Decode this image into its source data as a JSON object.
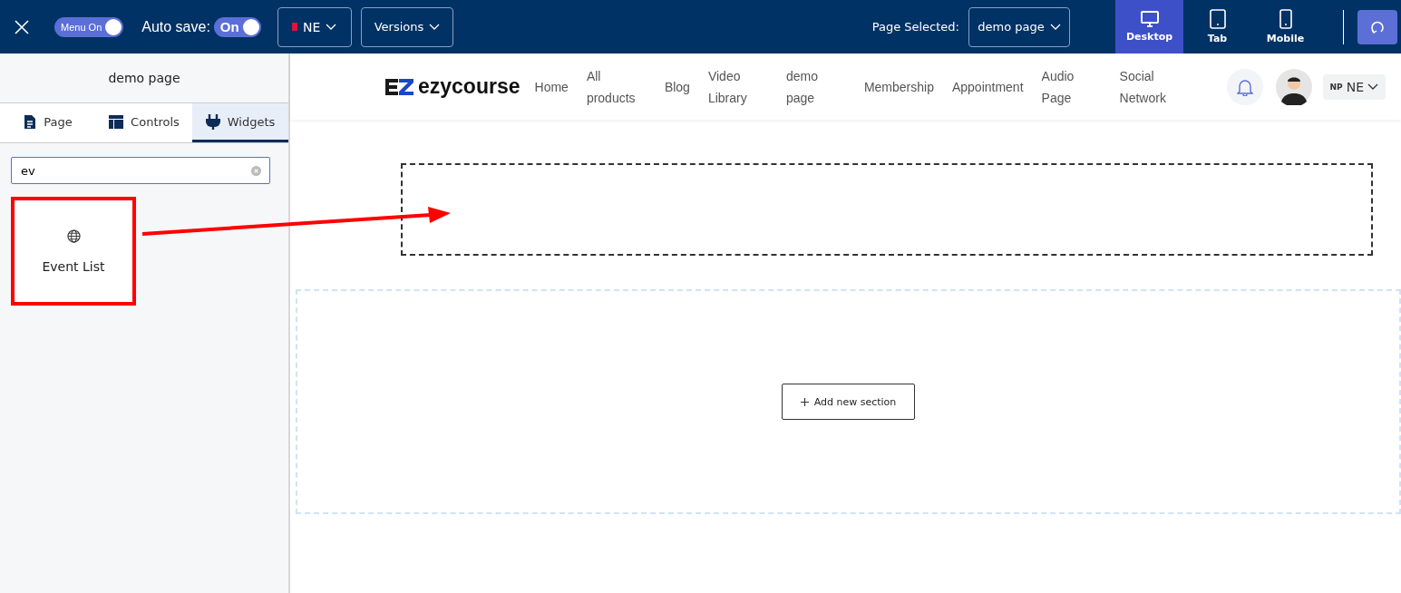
{
  "toolbar": {
    "menu_toggle": {
      "label": "Menu On",
      "on": true
    },
    "auto_save": {
      "label": "Auto save:",
      "toggle_label": "On",
      "on": true
    },
    "language": {
      "label": "NE"
    },
    "versions": {
      "label": "Versions"
    },
    "page_selected": {
      "label": "Page Selected:",
      "value": "demo page"
    },
    "devices": [
      {
        "label": "Desktop",
        "kind": "desktop",
        "selected": true
      },
      {
        "label": "Tab",
        "kind": "tablet",
        "selected": false
      },
      {
        "label": "Mobile",
        "kind": "mobile",
        "selected": false
      }
    ]
  },
  "sidebar": {
    "title": "demo page",
    "tabs": [
      {
        "label": "Page",
        "kind": "page",
        "selected": false
      },
      {
        "label": "Controls",
        "kind": "controls",
        "selected": false
      },
      {
        "label": "Widgets",
        "kind": "widgets",
        "selected": true
      }
    ],
    "search": {
      "value": "ev"
    },
    "widgets": [
      {
        "label": "Event List",
        "highlighted": true
      }
    ]
  },
  "preview": {
    "logo": "ezycourse",
    "nav": [
      "Home",
      "All products",
      "Blog",
      "Video Library",
      "demo page",
      "Membership",
      "Appointment",
      "Audio Page",
      "Social Network"
    ],
    "language": {
      "code": "NP",
      "label": "NE"
    }
  },
  "canvas": {
    "add_section": "Add new section"
  }
}
